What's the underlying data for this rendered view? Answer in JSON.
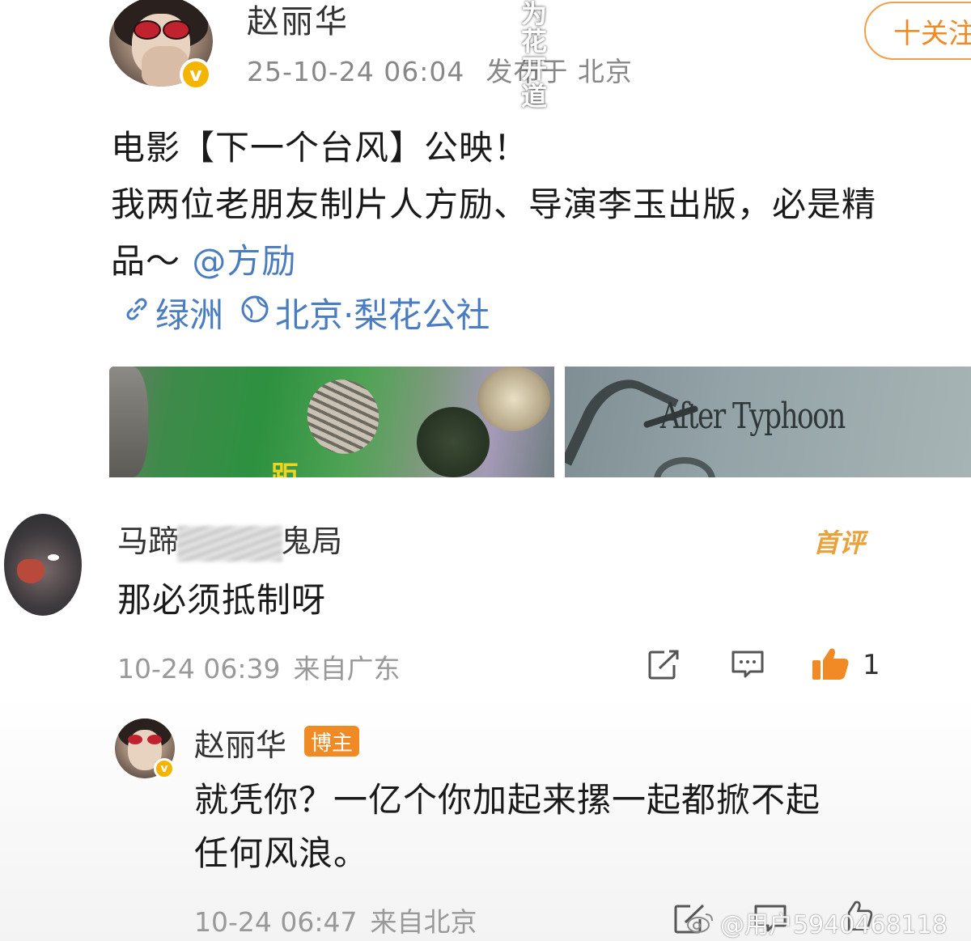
{
  "post": {
    "author": "赵丽华",
    "verified_icon": "verified-v-icon",
    "verified_mark": "v",
    "timestamp": "25-10-24 06:04",
    "location": "发布于 北京",
    "follow_label": "十关注",
    "text_line1": "电影【下一个台风】公映！",
    "text_line2": "我两位老朋友制片人方励、导演李玉出版，必是精",
    "text_line3_prefix": "品～",
    "mention": "@方励",
    "tag_link_label": "绿洲",
    "tag_location_label": "北京·梨花公社",
    "image_left_vertical_text": "为花开道",
    "image_left_caption": "距",
    "image_right_title": "After Typhoon",
    "colors": {
      "link_blue": "#4a7cc1",
      "accent_orange": "#f08a24",
      "verified_gold": "#f5b400"
    }
  },
  "comment": {
    "name_prefix": "马蹄",
    "name_suffix": "鬼局",
    "badge": "首评",
    "text": "那必须抵制呀",
    "timestamp": "10-24 06:39",
    "source": "来自广东",
    "like_count": "1",
    "icons": [
      "share-icon",
      "comment-icon",
      "like-icon"
    ]
  },
  "reply": {
    "name": "赵丽华",
    "author_badge": "博主",
    "verified_mark": "v",
    "text_line1": "就凭你？一亿个你加起来摞一起都掀不起",
    "text_line2": "任何风浪。",
    "timestamp": "10-24 06:47",
    "source": "来自北京"
  },
  "watermark": "@用户5940468118"
}
